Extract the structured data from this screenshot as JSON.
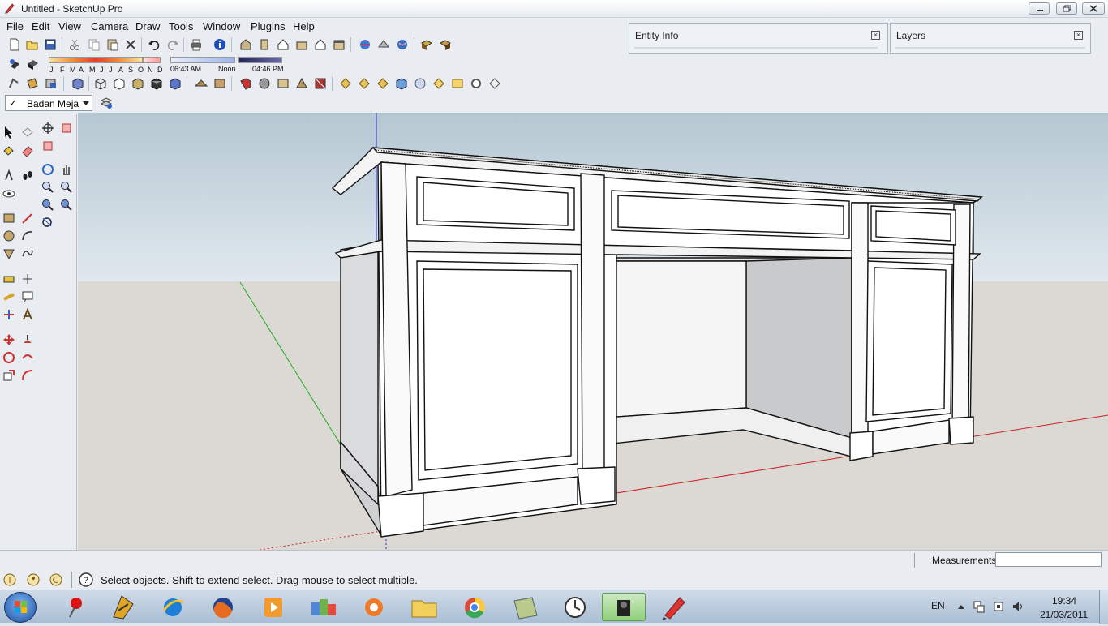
{
  "window": {
    "title": "Untitled - SketchUp Pro"
  },
  "menu": [
    "File",
    "Edit",
    "View",
    "Camera",
    "Draw",
    "Tools",
    "Window",
    "Plugins",
    "Help"
  ],
  "panels": {
    "entity_info": "Entity Info",
    "layers": "Layers",
    "close_glyph": "☒"
  },
  "shadows": {
    "months": [
      "J",
      "F",
      "M",
      "A",
      "M",
      "J",
      "J",
      "A",
      "S",
      "O",
      "N",
      "D"
    ],
    "time_start": "06:43 AM",
    "time_noon": "Noon",
    "time_end": "04:46 PM"
  },
  "layer_selector": {
    "check": "✓",
    "value": "Badan Meja"
  },
  "status": {
    "message": "Select objects. Shift to extend select. Drag mouse to select multiple.",
    "measurements_label": "Measurements",
    "measurements_value": ""
  },
  "taskbar": {
    "language": "EN",
    "time": "19:34",
    "date": "21/03/2011",
    "apps": [
      "start",
      "pin",
      "winamp",
      "internet-explorer",
      "firefox",
      "media-player",
      "pictures",
      "orb",
      "explorer",
      "chrome",
      "green-app",
      "clock",
      "media-camera",
      "sketchup"
    ]
  },
  "colors": {
    "accent_axis_red": "#cc2222",
    "accent_axis_green": "#22aa22",
    "accent_axis_blue": "#2233cc",
    "sky": "#c9d6de",
    "ground": "#dedbd6"
  }
}
